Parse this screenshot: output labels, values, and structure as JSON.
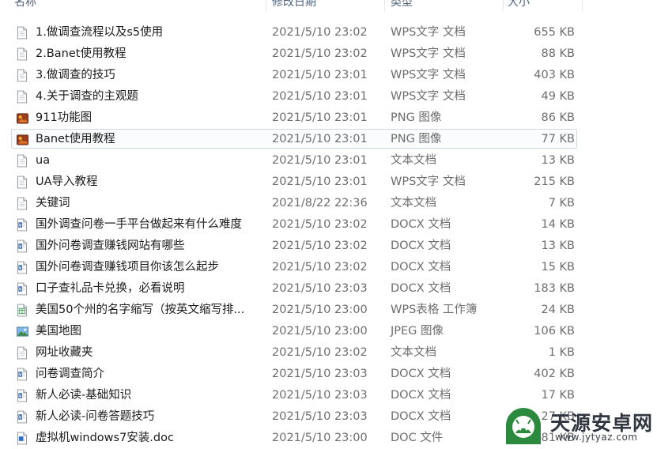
{
  "columns": {
    "name": "名称",
    "date": "修改日期",
    "type": "类型",
    "size": "大小"
  },
  "files": [
    {
      "name": "1.做调查流程以及s5使用",
      "date": "2021/5/10 23:02",
      "type": "WPS文字 文档",
      "size": "655 KB",
      "icon": "wps-document-icon"
    },
    {
      "name": "2.Banet使用教程",
      "date": "2021/5/10 23:02",
      "type": "WPS文字 文档",
      "size": "88 KB",
      "icon": "wps-document-icon"
    },
    {
      "name": "3.做调查的技巧",
      "date": "2021/5/10 23:01",
      "type": "WPS文字 文档",
      "size": "403 KB",
      "icon": "wps-document-icon"
    },
    {
      "name": "4.关于调查的主观题",
      "date": "2021/5/10 23:01",
      "type": "WPS文字 文档",
      "size": "49 KB",
      "icon": "wps-document-icon"
    },
    {
      "name": "911功能图",
      "date": "2021/5/10 23:01",
      "type": "PNG 图像",
      "size": "86 KB",
      "icon": "png-image-icon"
    },
    {
      "name": "Banet使用教程",
      "date": "2021/5/10 23:01",
      "type": "PNG 图像",
      "size": "77 KB",
      "icon": "png-image-icon",
      "selected": true
    },
    {
      "name": "ua",
      "date": "2021/5/10 23:01",
      "type": "文本文档",
      "size": "13 KB",
      "icon": "text-file-icon"
    },
    {
      "name": "UA导入教程",
      "date": "2021/5/10 23:01",
      "type": "WPS文字 文档",
      "size": "215 KB",
      "icon": "wps-document-icon"
    },
    {
      "name": "关键词",
      "date": "2021/8/22 22:36",
      "type": "文本文档",
      "size": "7 KB",
      "icon": "text-file-icon"
    },
    {
      "name": "国外调查问卷一手平台做起来有什么难度",
      "date": "2021/5/10 23:02",
      "type": "DOCX 文档",
      "size": "14 KB",
      "icon": "docx-document-icon"
    },
    {
      "name": "国外问卷调查赚钱网站有哪些",
      "date": "2021/5/10 23:02",
      "type": "DOCX 文档",
      "size": "13 KB",
      "icon": "docx-document-icon"
    },
    {
      "name": "国外问卷调查赚钱项目你该怎么起步",
      "date": "2021/5/10 23:02",
      "type": "DOCX 文档",
      "size": "15 KB",
      "icon": "docx-document-icon"
    },
    {
      "name": "口子查礼品卡兑换，必看说明",
      "date": "2021/5/10 23:03",
      "type": "DOCX 文档",
      "size": "183 KB",
      "icon": "docx-document-icon"
    },
    {
      "name": "美国50个州的名字缩写（按英文缩写排...",
      "date": "2021/5/10 23:00",
      "type": "WPS表格 工作簿",
      "size": "24 KB",
      "icon": "wps-spreadsheet-icon"
    },
    {
      "name": "美国地图",
      "date": "2021/5/10 23:00",
      "type": "JPEG 图像",
      "size": "106 KB",
      "icon": "jpeg-image-icon"
    },
    {
      "name": "网址收藏夹",
      "date": "2021/5/10 23:02",
      "type": "文本文档",
      "size": "1 KB",
      "icon": "text-file-icon"
    },
    {
      "name": "问卷调查简介",
      "date": "2021/5/10 23:03",
      "type": "DOCX 文档",
      "size": "402 KB",
      "icon": "docx-document-icon"
    },
    {
      "name": "新人必读-基础知识",
      "date": "2021/5/10 23:03",
      "type": "DOCX 文档",
      "size": "17 KB",
      "icon": "docx-document-icon"
    },
    {
      "name": "新人必读-问卷答题技巧",
      "date": "2021/5/10 23:03",
      "type": "DOCX 文档",
      "size": "27 KB",
      "icon": "docx-document-icon"
    },
    {
      "name": "虚拟机windows7安装.doc",
      "date": "2021/5/10 23:00",
      "type": "DOC 文件",
      "size": "81 KB",
      "icon": "doc-file-icon"
    }
  ],
  "watermark": {
    "title": "天源安卓网",
    "url": "www.jytyaz.com"
  },
  "colors": {
    "selection_border": "#cfd7e1",
    "header_text": "#4c607a",
    "secondary_text": "#6d6d6d",
    "docx_blue": "#2f6fc1",
    "wps_blue": "#3b7dd8"
  }
}
